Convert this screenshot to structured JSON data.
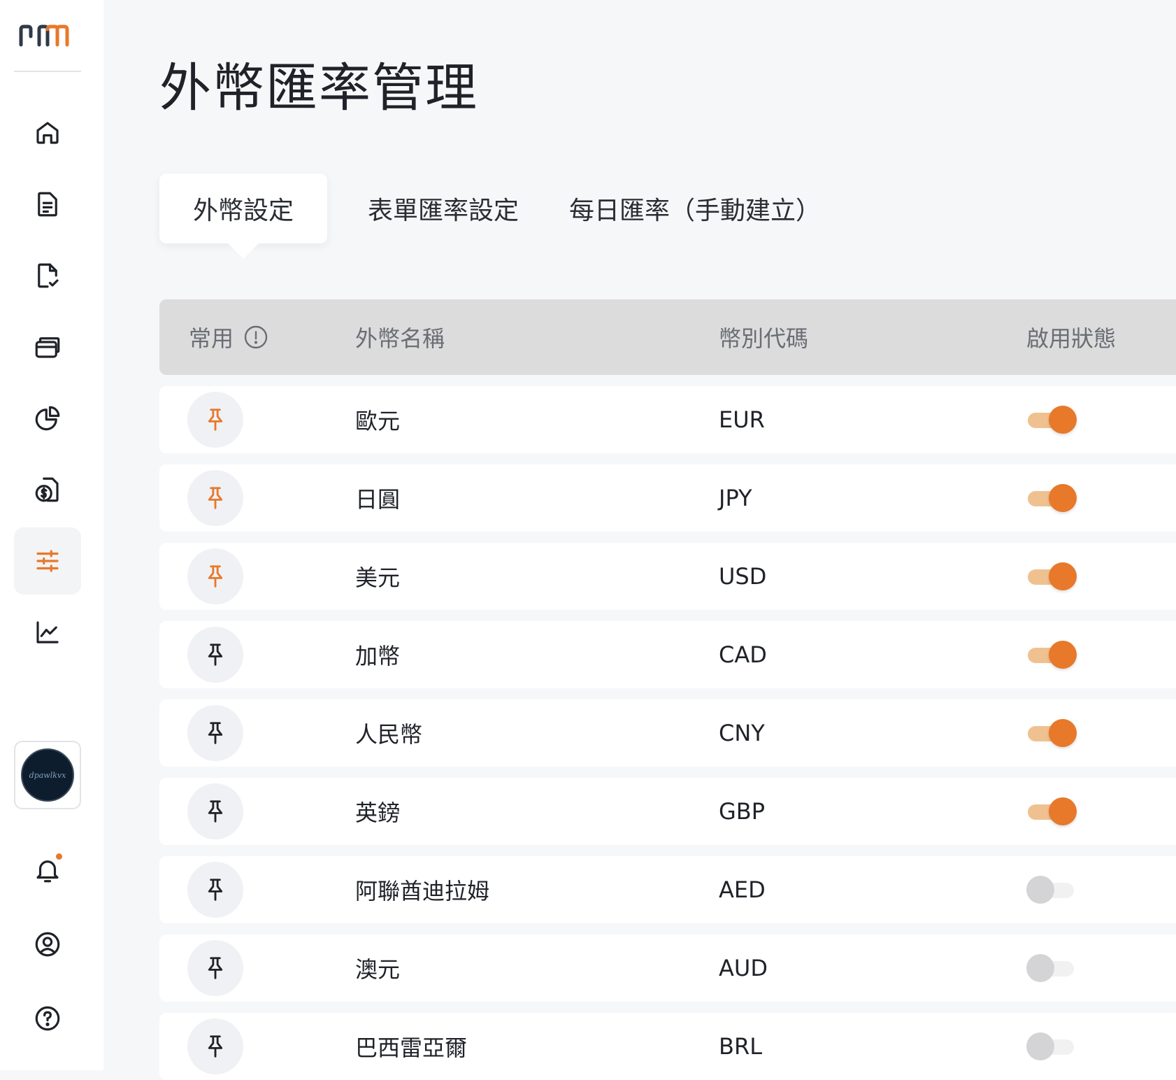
{
  "page": {
    "title": "外幣匯率管理"
  },
  "tabs": [
    {
      "label": "外幣設定",
      "active": true
    },
    {
      "label": "表單匯率設定",
      "active": false
    },
    {
      "label": "每日匯率（手動建立）",
      "active": false
    }
  ],
  "table": {
    "headers": {
      "pinned": "常用",
      "name": "外幣名稱",
      "code": "幣別代碼",
      "status": "啟用狀態"
    },
    "rows": [
      {
        "name": "歐元",
        "code": "EUR",
        "pinned": true,
        "enabled": true
      },
      {
        "name": "日圓",
        "code": "JPY",
        "pinned": true,
        "enabled": true
      },
      {
        "name": "美元",
        "code": "USD",
        "pinned": true,
        "enabled": true
      },
      {
        "name": "加幣",
        "code": "CAD",
        "pinned": false,
        "enabled": true
      },
      {
        "name": "人民幣",
        "code": "CNY",
        "pinned": false,
        "enabled": true
      },
      {
        "name": "英鎊",
        "code": "GBP",
        "pinned": false,
        "enabled": true
      },
      {
        "name": "阿聯酋迪拉姆",
        "code": "AED",
        "pinned": false,
        "enabled": false
      },
      {
        "name": "澳元",
        "code": "AUD",
        "pinned": false,
        "enabled": false
      },
      {
        "name": "巴西雷亞爾",
        "code": "BRL",
        "pinned": false,
        "enabled": false
      }
    ]
  },
  "user": {
    "avatar_text": "dpawlkvx"
  },
  "colors": {
    "accent": "#e8782a",
    "accent_light": "#f0c190",
    "icon_dark": "#1f2228",
    "logo_dark": "#2f3a48"
  },
  "icons": {
    "nav": [
      "home-icon",
      "document-icon",
      "file-check-icon",
      "card-icon",
      "pie-chart-icon",
      "dollar-doc-icon",
      "sliders-icon",
      "line-chart-icon"
    ],
    "bottom": [
      "bell-icon",
      "user-circle-icon",
      "help-icon"
    ]
  }
}
